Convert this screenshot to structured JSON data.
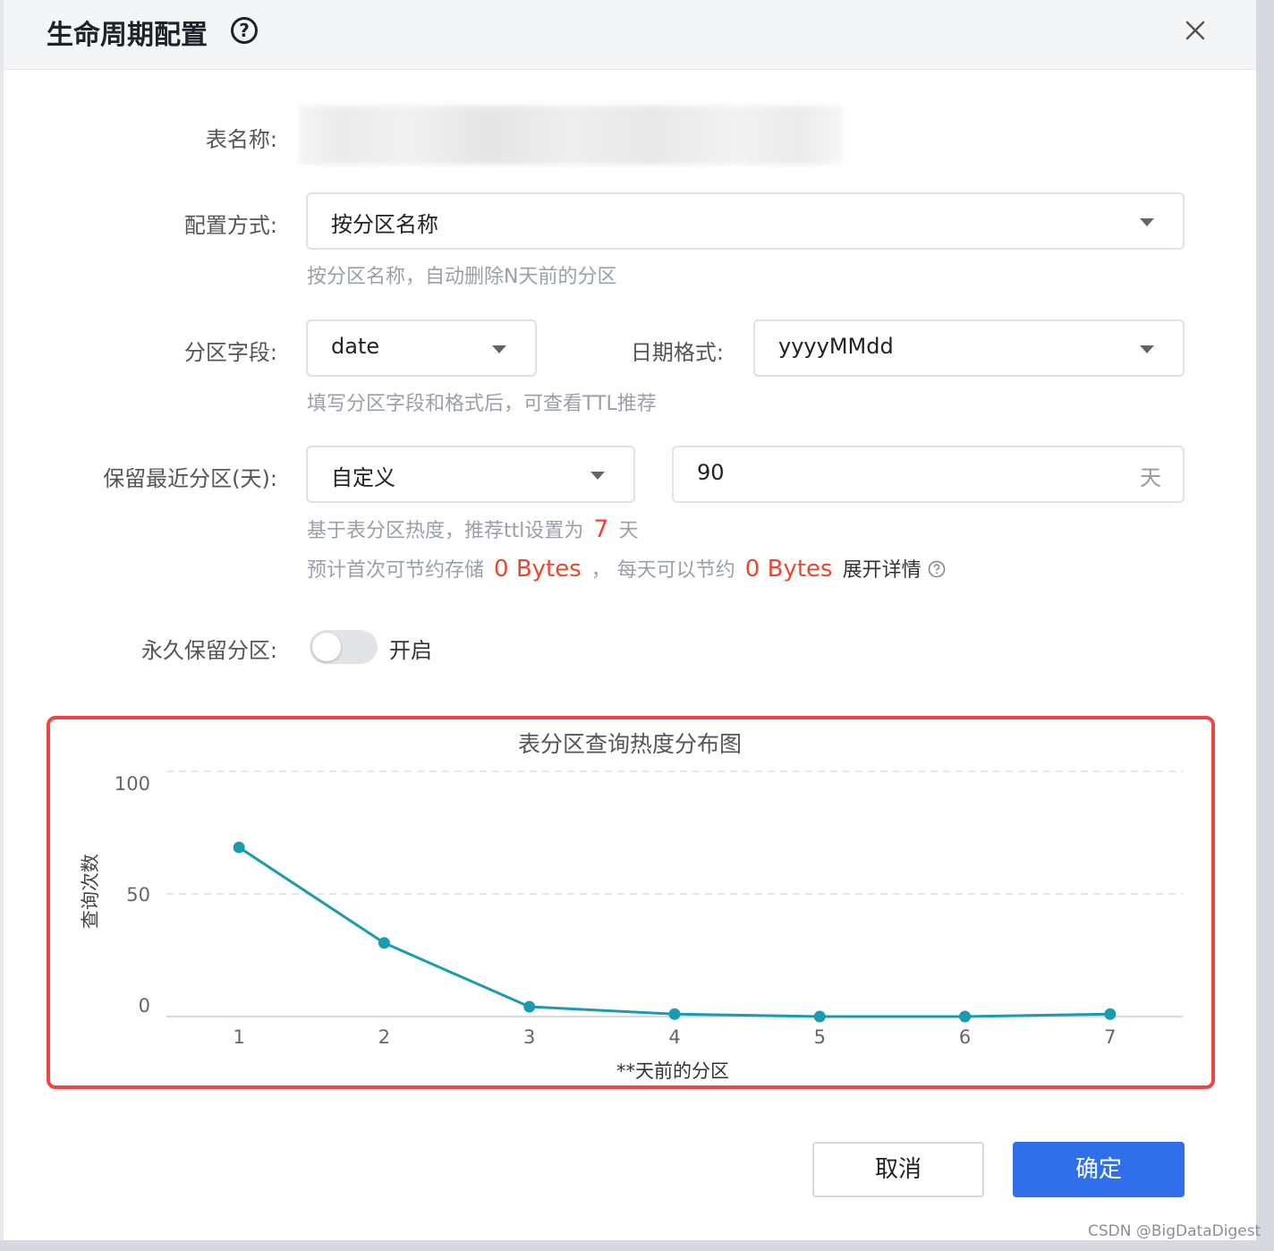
{
  "dialog": {
    "title": "生命周期配置",
    "help_glyph": "?",
    "close_icon": "close-icon"
  },
  "form": {
    "table_name": {
      "label": "表名称:"
    },
    "config_mode": {
      "label": "配置方式:",
      "value": "按分区名称",
      "hint": "按分区名称，自动删除N天前的分区"
    },
    "partition_field": {
      "label": "分区字段:",
      "value": "date"
    },
    "date_format": {
      "label": "日期格式:",
      "value": "yyyyMMdd"
    },
    "partition_hint": "填写分区字段和格式后，可查看TTL推荐",
    "retain": {
      "label": "保留最近分区(天):",
      "mode": "自定义",
      "days": "90",
      "unit": "天",
      "rec_prefix": "基于表分区热度，推荐ttl设置为",
      "rec_value": "7",
      "rec_suffix": "天",
      "save_prefix": "预计首次可节约存储",
      "save_first": "0 Bytes",
      "save_mid": "，  每天可以节约",
      "save_daily": "0 Bytes",
      "expand": "展开详情"
    },
    "permanent": {
      "label": "永久保留分区:",
      "toggle_on": false,
      "toggle_text": "开启"
    }
  },
  "chart_data": {
    "type": "line",
    "title": "表分区查询热度分布图",
    "xlabel": "**天前的分区",
    "ylabel": "查询次数",
    "categories": [
      "1",
      "2",
      "3",
      "4",
      "5",
      "6",
      "7"
    ],
    "values": [
      69,
      30,
      4,
      1,
      0,
      0,
      1
    ],
    "ylim": [
      0,
      100
    ],
    "yticks": [
      "0",
      "50",
      "100"
    ],
    "grid": true,
    "color": "#1a9bb0"
  },
  "footer": {
    "cancel": "取消",
    "confirm": "确定"
  },
  "credit": "CSDN @BigDataDigest",
  "colors": {
    "primary": "#2f6fea",
    "highlight": "#e8492d",
    "chart_line": "#1a9bb0",
    "chart_border": "#ef4444"
  }
}
